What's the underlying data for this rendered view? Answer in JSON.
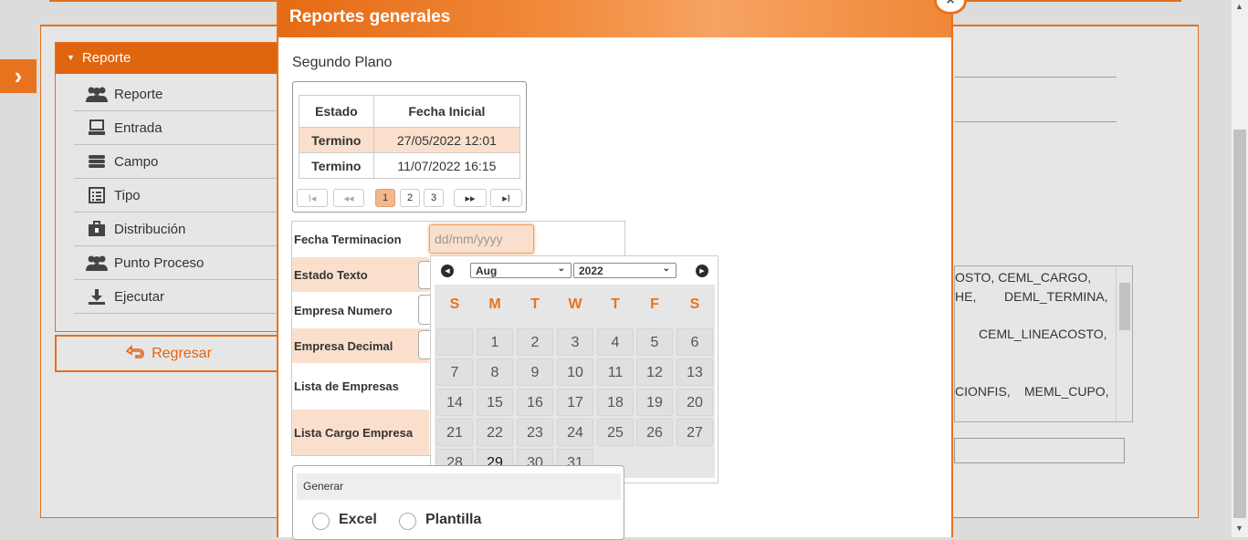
{
  "sidebar": {
    "header": "Reporte",
    "items": [
      {
        "label": "Reporte",
        "icon": "users-icon"
      },
      {
        "label": "Entrada",
        "icon": "monitor-icon"
      },
      {
        "label": "Campo",
        "icon": "database-icon"
      },
      {
        "label": "Tipo",
        "icon": "list-icon"
      },
      {
        "label": "Distribución",
        "icon": "briefcase-icon"
      },
      {
        "label": "Punto Proceso",
        "icon": "users-icon"
      },
      {
        "label": "Ejecutar",
        "icon": "download-icon"
      }
    ],
    "back_label": "Regresar"
  },
  "background": {
    "textarea_lines": [
      "OSTO, CEML_CARGO,",
      "HE,",
      "DEML_TERMINA,",
      "CEML_LINEACOSTO,",
      "CIONFIS,",
      "MEML_CUPO,"
    ]
  },
  "modal": {
    "title": "Reportes generales",
    "close_label": "×",
    "section_title": "Segundo Plano",
    "grid": {
      "headers": [
        "Estado",
        "Fecha Inicial"
      ],
      "rows": [
        [
          "Termino",
          "27/05/2022 12:01"
        ],
        [
          "Termino",
          "11/07/2022 16:15"
        ]
      ],
      "pager": {
        "first": "I◂",
        "prev": "◂◂",
        "pages": [
          "1",
          "2",
          "3"
        ],
        "current": "1",
        "next": "▸▸",
        "last": "▸I"
      }
    },
    "form": {
      "fecha_terminacion_label": "Fecha Terminacion",
      "fecha_placeholder": "dd/mm/yyyy",
      "estado_texto_label": "Estado Texto",
      "empresa_numero_label": "Empresa Numero",
      "empresa_decimal_label": "Empresa Decimal",
      "lista_empresas_label": "Lista de Empresas",
      "lista_cargo_label": "Lista Cargo Empresa"
    },
    "datepicker": {
      "month": "Aug",
      "year": "2022",
      "prev_icon": "◀",
      "next_icon": "▶",
      "weekdays": [
        "S",
        "M",
        "T",
        "W",
        "T",
        "F",
        "S"
      ],
      "weeks": [
        [
          "",
          "1",
          "2",
          "3",
          "4",
          "5",
          "6"
        ],
        [
          "7",
          "8",
          "9",
          "10",
          "11",
          "12",
          "13"
        ],
        [
          "14",
          "15",
          "16",
          "17",
          "18",
          "19",
          "20"
        ],
        [
          "21",
          "22",
          "23",
          "24",
          "25",
          "26",
          "27"
        ],
        [
          "28",
          "29",
          "30",
          "31",
          "",
          "",
          ""
        ]
      ],
      "today": "29"
    },
    "generar": {
      "title": "Generar",
      "options": [
        "Excel",
        "Plantilla"
      ]
    }
  },
  "colors": {
    "accent": "#e8731e",
    "highlight": "#fae0cc"
  }
}
